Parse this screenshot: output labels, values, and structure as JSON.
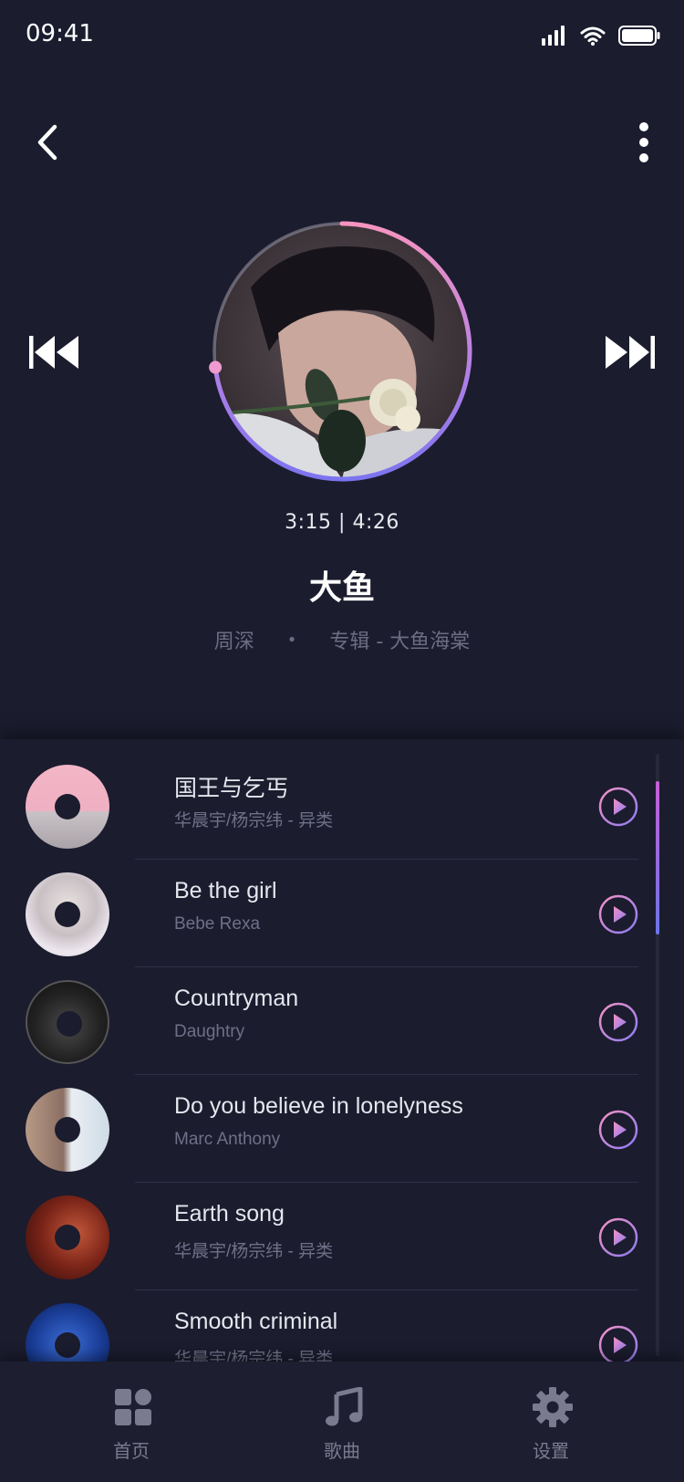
{
  "status_bar": {
    "time": "09:41"
  },
  "player": {
    "elapsed": "3:15",
    "duration": "4:26",
    "time_display": "3:15 | 4:26",
    "progress": 0.73,
    "title": "大鱼",
    "artist": "周深",
    "separator": "•",
    "album": "专辑 - 大鱼海棠"
  },
  "playlist": [
    {
      "title": "国王与乞丐",
      "artist": "华晨宇/杨宗纬 - 异类"
    },
    {
      "title": "Be the girl",
      "artist": "Bebe Rexa"
    },
    {
      "title": "Countryman",
      "artist": "Daughtry"
    },
    {
      "title": "Do you believe in lonelyness",
      "artist": "Marc Anthony"
    },
    {
      "title": "Earth song",
      "artist": "华晨宇/杨宗纬 - 异类"
    },
    {
      "title": "Smooth criminal",
      "artist": "华晨宇/杨宗纬 - 异类"
    }
  ],
  "tabs": [
    {
      "label": "首页",
      "icon": "home-grid-icon"
    },
    {
      "label": "歌曲",
      "icon": "music-note-icon"
    },
    {
      "label": "设置",
      "icon": "gear-icon"
    }
  ],
  "colors": {
    "background": "#1b1c2e",
    "accent_pink": "#f08cc0",
    "accent_purple": "#8a78f0",
    "muted_text": "#6c6d82"
  }
}
